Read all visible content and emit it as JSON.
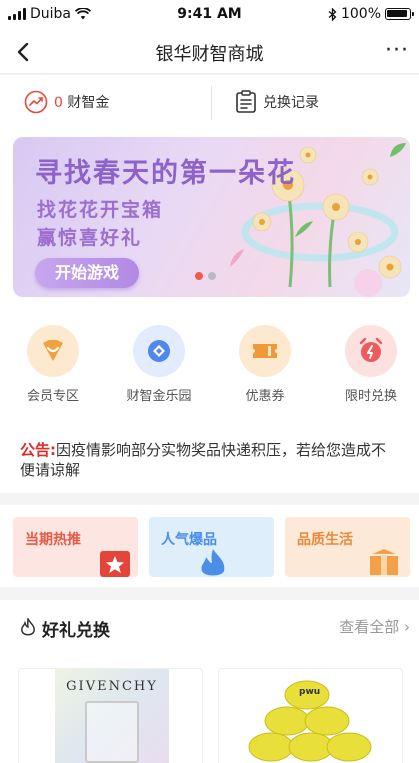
{
  "status": {
    "carrier": "Duiba",
    "time": "9:41 AM",
    "battery": "100%"
  },
  "nav": {
    "title": "银华财智商城",
    "more": "···"
  },
  "topbar": {
    "coin_value": "0",
    "coin_label": "财智金",
    "record_label": "兑换记录"
  },
  "banner": {
    "headline": "寻找春天的第一朵花",
    "line1": "找花花开宝箱",
    "line2": "赢惊喜好礼",
    "button": "开始游戏",
    "active_dot_color": "#f05a4a",
    "inactive_dot_color": "#b8b8c8"
  },
  "categories": [
    {
      "label": "会员专区",
      "icon": "diamond-heart-icon",
      "bg": "#fde9cf",
      "fg": "#f0a23c"
    },
    {
      "label": "财智金乐园",
      "icon": "coin-diamond-icon",
      "bg": "#e2ecfd",
      "fg": "#4f86ef"
    },
    {
      "label": "优惠券",
      "icon": "ticket-icon",
      "bg": "#fde9cf",
      "fg": "#ef9a36"
    },
    {
      "label": "限时兑换",
      "icon": "alarm-clock-icon",
      "bg": "#fde1e1",
      "fg": "#ef5a5a"
    }
  ],
  "notice": {
    "tag": "公告:",
    "text": "因疫情影响部分实物奖品快递积压，若给您造成不便请谅解"
  },
  "tiles": [
    {
      "label": "当期热推",
      "color": "#e45a48",
      "bg": "#fde5e2",
      "icon": "star-gift-icon"
    },
    {
      "label": "人气爆品",
      "color": "#4a8ee8",
      "bg": "#dfeefb",
      "icon": "flame-icon"
    },
    {
      "label": "品质生活",
      "color": "#e88a3a",
      "bg": "#fde9d8",
      "icon": "box-icon"
    }
  ],
  "section": {
    "title": "好礼兑换",
    "view_all": "查看全部",
    "icon": "flame-outline-icon"
  },
  "products": [
    {
      "brand_text": "GIVENCHY"
    },
    {
      "brand_text": "pwu"
    }
  ]
}
